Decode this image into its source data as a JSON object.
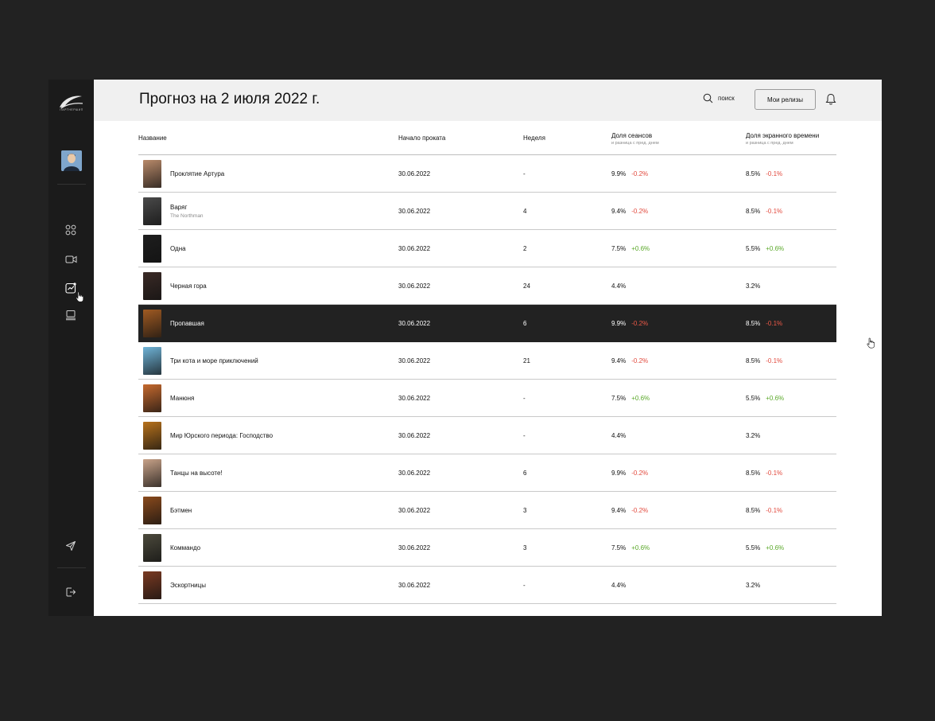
{
  "header": {
    "title": "Прогноз на 2 июля 2022 г.",
    "search_label": "поиск",
    "releases_button": "Мои релизы"
  },
  "sidebar": {
    "logo_text": "ПАРТНЕРШИП",
    "icons": [
      "dashboard-icon",
      "video-icon",
      "analytics-icon",
      "monitor-icon",
      "send-icon",
      "logout-icon"
    ]
  },
  "table": {
    "columns": {
      "title": "Название",
      "start": "Начало проката",
      "week": "Неделя",
      "share": "Доля сеансов",
      "share_sub": "и разница с пред. днем",
      "screen": "Доля экранного времени",
      "screen_sub": "и разница с пред. днем"
    },
    "rows": [
      {
        "title": "Проклятие Артура",
        "subtitle": "",
        "start": "30.06.2022",
        "week": "-",
        "share": "9.9%",
        "share_diff": "-0.2%",
        "screen": "8.5%",
        "screen_diff": "-0.1%",
        "poster_color": "#b98a6a"
      },
      {
        "title": "Варяг",
        "subtitle": "The Northman",
        "start": "30.06.2022",
        "week": "4",
        "share": "9.4%",
        "share_diff": "-0.2%",
        "screen": "8.5%",
        "screen_diff": "-0.1%",
        "poster_color": "#4a4a4a"
      },
      {
        "title": "Одна",
        "subtitle": "",
        "start": "30.06.2022",
        "week": "2",
        "share": "7.5%",
        "share_diff": "+0.6%",
        "screen": "5.5%",
        "screen_diff": "+0.6%",
        "poster_color": "#1e1e1e"
      },
      {
        "title": "Черная гора",
        "subtitle": "",
        "start": "30.06.2022",
        "week": "24",
        "share": "4.4%",
        "share_diff": "",
        "screen": "3.2%",
        "screen_diff": "",
        "poster_color": "#3a2a26"
      },
      {
        "title": "Пропавшая",
        "subtitle": "",
        "start": "30.06.2022",
        "week": "6",
        "share": "9.9%",
        "share_diff": "-0.2%",
        "screen": "8.5%",
        "screen_diff": "-0.1%",
        "poster_color": "#a05a22"
      },
      {
        "title": "Три кота и море приключений",
        "subtitle": "",
        "start": "30.06.2022",
        "week": "21",
        "share": "9.4%",
        "share_diff": "-0.2%",
        "screen": "8.5%",
        "screen_diff": "-0.1%",
        "poster_color": "#6fb4d8"
      },
      {
        "title": "Манюня",
        "subtitle": "",
        "start": "30.06.2022",
        "week": "-",
        "share": "7.5%",
        "share_diff": "+0.6%",
        "screen": "5.5%",
        "screen_diff": "+0.6%",
        "poster_color": "#c6692e"
      },
      {
        "title": "Мир Юрского периода: Господство",
        "subtitle": "",
        "start": "30.06.2022",
        "week": "-",
        "share": "4.4%",
        "share_diff": "",
        "screen": "3.2%",
        "screen_diff": "",
        "poster_color": "#b8721c"
      },
      {
        "title": "Танцы на высоте!",
        "subtitle": "",
        "start": "30.06.2022",
        "week": "6",
        "share": "9.9%",
        "share_diff": "-0.2%",
        "screen": "8.5%",
        "screen_diff": "-0.1%",
        "poster_color": "#c9a389"
      },
      {
        "title": "Бэтмен",
        "subtitle": "",
        "start": "30.06.2022",
        "week": "3",
        "share": "9.4%",
        "share_diff": "-0.2%",
        "screen": "8.5%",
        "screen_diff": "-0.1%",
        "poster_color": "#8a4a1c"
      },
      {
        "title": "Коммандо",
        "subtitle": "",
        "start": "30.06.2022",
        "week": "3",
        "share": "7.5%",
        "share_diff": "+0.6%",
        "screen": "5.5%",
        "screen_diff": "+0.6%",
        "poster_color": "#4c4a3c"
      },
      {
        "title": "Эскортницы",
        "subtitle": "",
        "start": "30.06.2022",
        "week": "-",
        "share": "4.4%",
        "share_diff": "",
        "screen": "3.2%",
        "screen_diff": "",
        "poster_color": "#7a3a22"
      }
    ],
    "active_row": 4
  },
  "colors": {
    "background": "#222222",
    "sidebar": "#1b1b1b",
    "topbar": "#f0f0f0",
    "negative": "#e2493d",
    "positive": "#5aa829",
    "active_row": "#222222"
  }
}
